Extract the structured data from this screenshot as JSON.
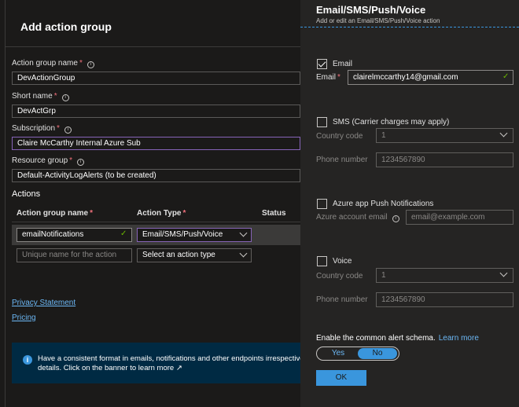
{
  "blade": {
    "title": "Add action group",
    "fields": {
      "name": {
        "label": "Action group name",
        "value": "DevActionGroup"
      },
      "short": {
        "label": "Short name",
        "value": "DevActGrp"
      },
      "subscription": {
        "label": "Subscription",
        "value": "Claire McCarthy Internal Azure Sub"
      },
      "rg": {
        "label": "Resource group",
        "value": "Default-ActivityLogAlerts (to be created)"
      }
    },
    "required_mark": "*",
    "actions": {
      "heading": "Actions",
      "col_name": "Action group name",
      "col_type": "Action Type",
      "col_status": "Status",
      "row1": {
        "name": "emailNotifications",
        "type": "Email/SMS/Push/Voice"
      },
      "row2": {
        "name_placeholder": "Unique name for the action",
        "type_placeholder": "Select an action type"
      }
    },
    "links": {
      "privacy": "Privacy Statement",
      "pricing": "Pricing"
    },
    "banner": {
      "line1": "Have a consistent format in emails, notifications and other endpoints irrespective",
      "line2": "details. Click on the banner to learn more"
    }
  },
  "panel": {
    "title": "Email/SMS/Push/Voice",
    "subtitle": "Add or edit an Email/SMS/Push/Voice action",
    "email": {
      "checkbox": "Email",
      "label": "Email",
      "value": "clairelmccarthy14@gmail.com",
      "checked": true
    },
    "sms": {
      "checkbox": "SMS (Carrier charges may apply)",
      "cc_label": "Country code",
      "cc_value": "1",
      "phone_label": "Phone number",
      "phone_placeholder": "1234567890",
      "checked": false
    },
    "push": {
      "checkbox": "Azure app Push Notifications",
      "label": "Azure account email",
      "placeholder": "email@example.com",
      "checked": false
    },
    "voice": {
      "checkbox": "Voice",
      "cc_label": "Country code",
      "cc_value": "1",
      "phone_label": "Phone number",
      "phone_placeholder": "1234567890",
      "checked": false
    },
    "schema": {
      "label": "Enable the common alert schema.",
      "learn": "Learn more",
      "yes": "Yes",
      "no": "No",
      "selected": "No"
    },
    "ok": "OK"
  },
  "colors": {
    "accent": "#3a96dd",
    "required": "#f1707b",
    "success": "#6bb700",
    "focus": "#8764b8",
    "link": "#6cb8f6"
  }
}
